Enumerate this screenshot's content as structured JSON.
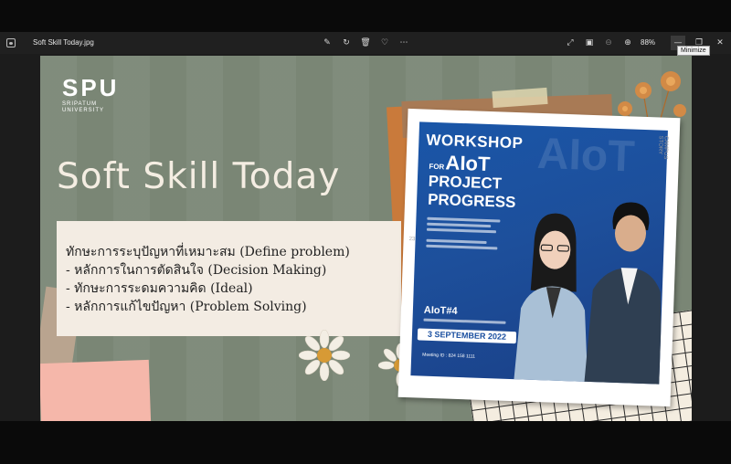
{
  "window": {
    "title": "Soft Skill Today.jpg",
    "zoom": "88%",
    "tooltip": "Minimize"
  },
  "slide": {
    "logo": "SPU",
    "logo_sub": "SRIPATUM UNIVERSITY",
    "title": "Soft Skill Today",
    "lines": [
      "ทักษะการระบุปัญหาที่เหมาะสม (Define problem)",
      "- หลักการในการตัดสินใจ (Decision Making)",
      "- ทักษะการระดมความคิด (Ideal)",
      "- หลักการแก้ไขปัญหา (Problem Solving)"
    ]
  },
  "poster": {
    "workshop": "WORKSHOP",
    "for": "FOR",
    "aiot": "AIoT",
    "project": "PROJECT",
    "progress": "PROGRESS",
    "watermark": "AIoT",
    "code": "AIoT#4",
    "date": "3 SEPTEMBER 2022",
    "meeting": "Meeting ID : 824 158 1111",
    "side_label": "CAMPUS STORY",
    "page_num": "23"
  },
  "icons": [
    "app-icon",
    "edit-icon",
    "rotate-icon",
    "delete-icon",
    "favorite-icon",
    "more-icon",
    "fullscreen-icon",
    "fit-icon",
    "zoom-out-icon",
    "zoom-in-icon",
    "minimize-icon",
    "restore-icon",
    "close-icon"
  ]
}
